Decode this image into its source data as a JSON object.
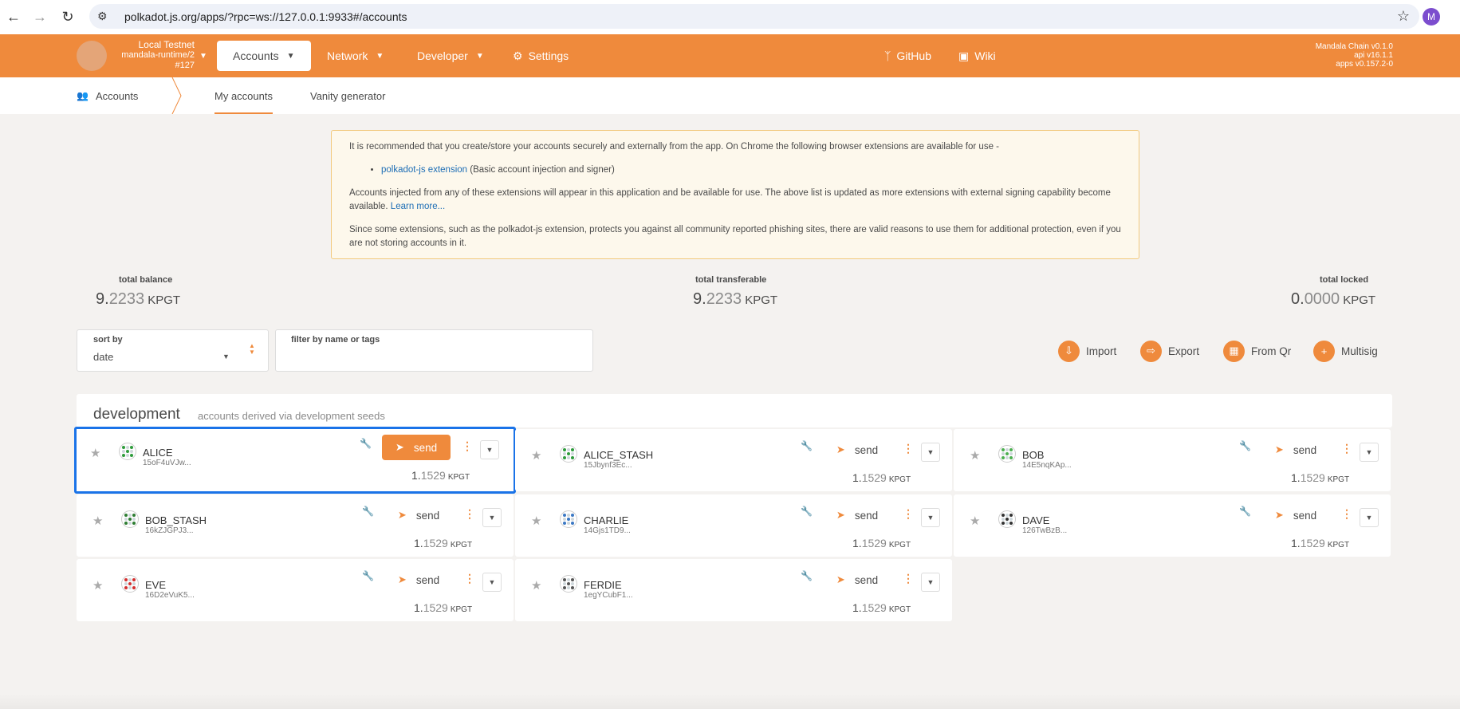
{
  "browser": {
    "url": "polkadot.js.org/apps/?rpc=ws://127.0.0.1:9933#/accounts",
    "profile_initial": "M"
  },
  "chain": {
    "name": "Local Testnet",
    "runtime": "mandala-runtime/2",
    "block": "#127"
  },
  "menu": {
    "accounts": "Accounts",
    "network": "Network",
    "developer": "Developer",
    "settings": "Settings",
    "github": "GitHub",
    "wiki": "Wiki"
  },
  "versions": {
    "chain": "Mandala Chain v0.1.0",
    "api": "api v16.1.1",
    "apps": "apps v0.157.2-0"
  },
  "tabs": {
    "section": "Accounts",
    "my_accounts": "My accounts",
    "vanity": "Vanity generator"
  },
  "notice": {
    "p1": "It is recommended that you create/store your accounts securely and externally from the app. On Chrome the following browser extensions are available for use -",
    "ext_link": "polkadot-js extension",
    "ext_desc": " (Basic account injection and signer)",
    "p2": "Accounts injected from any of these extensions will appear in this application and be available for use. The above list is updated as more extensions with external signing capability become available. ",
    "learn_more": "Learn more...",
    "p3": "Since some extensions, such as the polkadot-js extension, protects you against all community reported phishing sites, there are valid reasons to use them for additional protection, even if you are not storing accounts in it."
  },
  "summary": {
    "total_balance_label": "total balance",
    "total_balance_int": "9.",
    "total_balance_dec": "2233",
    "total_transferable_label": "total transferable",
    "total_transferable_int": "9.",
    "total_transferable_dec": "2233",
    "total_locked_label": "total locked",
    "total_locked_int": "0.",
    "total_locked_dec": "0000",
    "unit": "KPGT"
  },
  "filters": {
    "sort_label": "sort by",
    "sort_value": "date",
    "filter_label": "filter by name or tags"
  },
  "actions": {
    "import": "Import",
    "export": "Export",
    "from_qr": "From Qr",
    "multisig": "Multisig"
  },
  "group": {
    "title": "development",
    "subtitle": "accounts derived via development seeds"
  },
  "accounts": [
    {
      "name": "ALICE",
      "address": "15oF4uVJw...",
      "bal_int": "1.",
      "bal_dec": "1529",
      "unit": "KPGT",
      "send": "send"
    },
    {
      "name": "ALICE_STASH",
      "address": "15Jbynf3Ec...",
      "bal_int": "1.",
      "bal_dec": "1529",
      "unit": "KPGT",
      "send": "send"
    },
    {
      "name": "BOB",
      "address": "14E5nqKAp...",
      "bal_int": "1.",
      "bal_dec": "1529",
      "unit": "KPGT",
      "send": "send"
    },
    {
      "name": "BOB_STASH",
      "address": "16kZJGPJ3...",
      "bal_int": "1.",
      "bal_dec": "1529",
      "unit": "KPGT",
      "send": "send"
    },
    {
      "name": "CHARLIE",
      "address": "14Gjs1TD9...",
      "bal_int": "1.",
      "bal_dec": "1529",
      "unit": "KPGT",
      "send": "send"
    },
    {
      "name": "DAVE",
      "address": "126TwBzB...",
      "bal_int": "1.",
      "bal_dec": "1529",
      "unit": "KPGT",
      "send": "send"
    },
    {
      "name": "EVE",
      "address": "16D2eVuK5...",
      "bal_int": "1.",
      "bal_dec": "1529",
      "unit": "KPGT",
      "send": "send"
    },
    {
      "name": "FERDIE",
      "address": "1egYCubF1...",
      "bal_int": "1.",
      "bal_dec": "1529",
      "unit": "KPGT",
      "send": "send"
    }
  ],
  "colors": {
    "accent": "#ef8a3c",
    "selection": "#1a73e8"
  }
}
